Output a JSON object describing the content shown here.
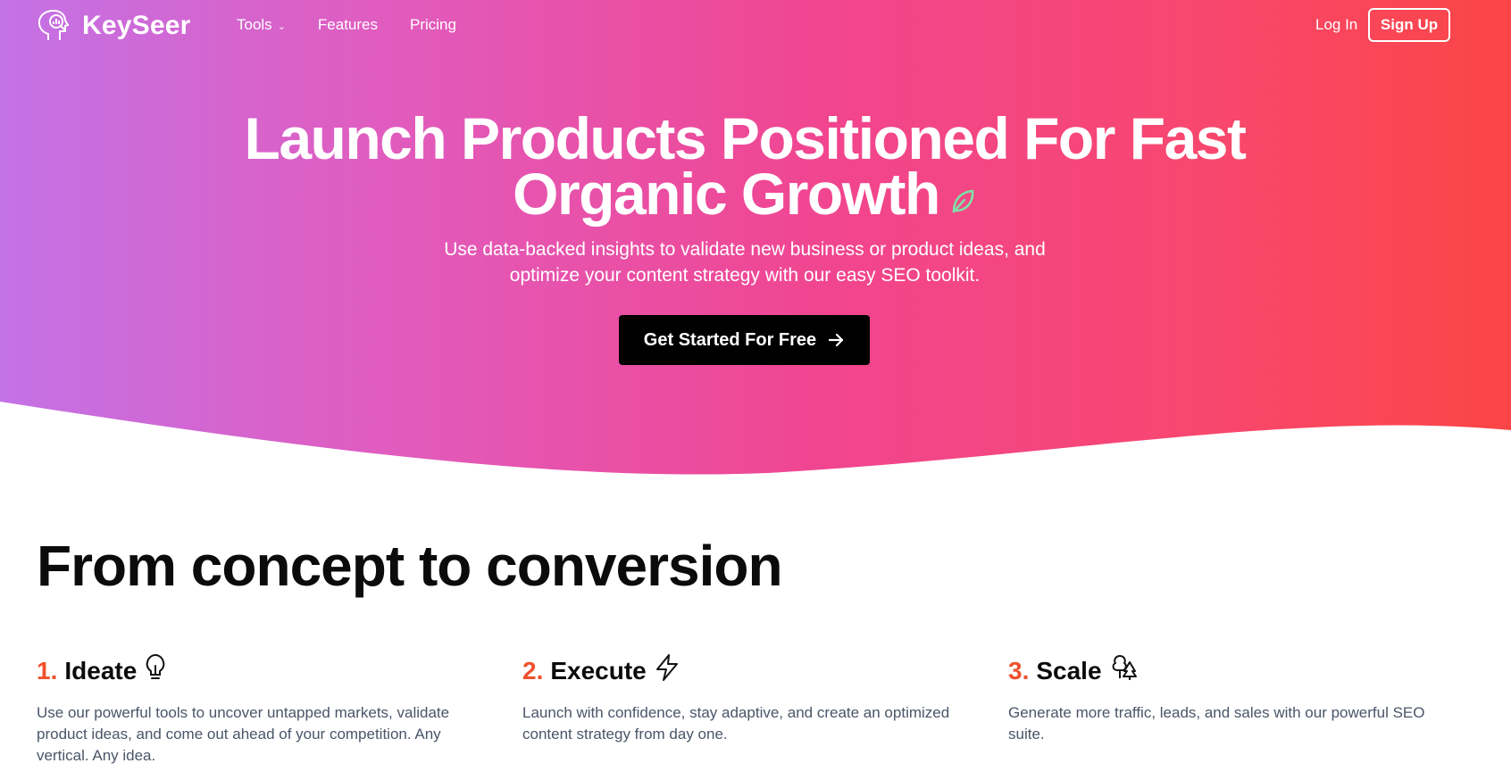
{
  "brand": {
    "name": "KeySeer"
  },
  "nav": {
    "items": [
      {
        "label": "Tools",
        "has_dropdown": true
      },
      {
        "label": "Features",
        "has_dropdown": false
      },
      {
        "label": "Pricing",
        "has_dropdown": false
      }
    ],
    "login": "Log In",
    "signup": "Sign Up"
  },
  "hero": {
    "headline_line1": "Launch Products Positioned For Fast",
    "headline_line2": "Organic Growth",
    "subtitle_line1": "Use data-backed insights to validate new business or product ideas, and",
    "subtitle_line2": "optimize your content strategy with our easy SEO toolkit.",
    "cta": "Get Started For Free"
  },
  "section": {
    "title": "From concept to conversion",
    "steps": [
      {
        "num": "1.",
        "title": "Ideate",
        "icon": "lightbulb-icon",
        "desc": "Use our powerful tools to uncover untapped markets, validate product ideas, and come out ahead of your competition. Any vertical. Any idea."
      },
      {
        "num": "2.",
        "title": "Execute",
        "icon": "lightning-icon",
        "desc": "Launch with confidence, stay adaptive, and create an optimized content strategy from day one."
      },
      {
        "num": "3.",
        "title": "Scale",
        "icon": "trees-icon",
        "desc": "Generate more traffic, leads, and sales with our powerful SEO suite."
      }
    ]
  },
  "colors": {
    "gradient_start": "#c372e6",
    "gradient_mid": "#f1458f",
    "gradient_end": "#fb4545",
    "step_number": "#f0512e",
    "cta_bg": "#000000",
    "leaf": "#7ee0a6"
  }
}
